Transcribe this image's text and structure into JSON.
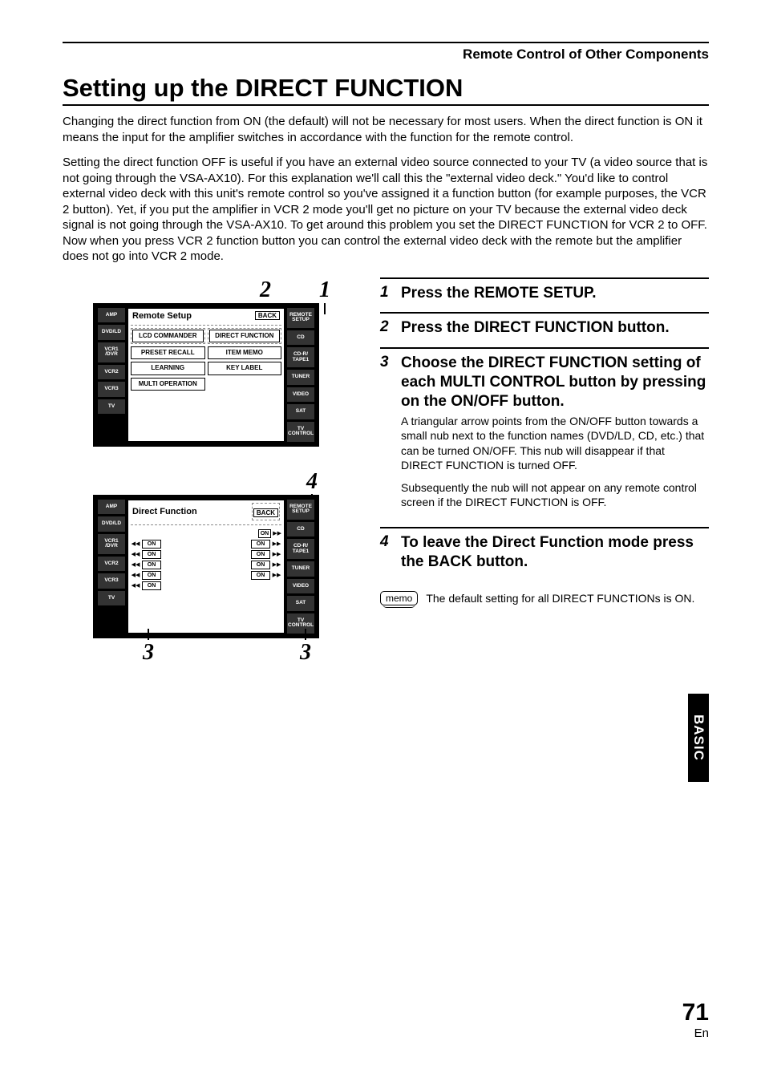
{
  "chapter": "Remote Control of Other Components",
  "title": "Setting up the DIRECT FUNCTION",
  "intro1": "Changing the direct function from ON (the default) will not be necessary for most users. When the direct function is ON it means the input for the amplifier switches in accordance with the function for the remote control.",
  "intro2": "Setting the direct function OFF is useful if you have an external video source connected to your TV (a video source that is not going through the VSA-AX10). For this explanation we'll call this the \"external video deck.\" You'd like to control external video deck with this unit's remote control so you've assigned it a function button (for example purposes, the VCR 2 button). Yet, if you put the amplifier in VCR 2 mode you'll get no picture on your TV because the external video deck signal is not going through the VSA-AX10. To get around this problem you set the DIRECT FUNCTION for VCR 2 to OFF. Now when you press VCR 2 function button you can control the external video deck with the remote but the amplifier does not go into VCR 2 mode.",
  "steps": [
    {
      "n": "1",
      "head": "Press the REMOTE SETUP.",
      "body": []
    },
    {
      "n": "2",
      "head": "Press the DIRECT FUNCTION button.",
      "body": []
    },
    {
      "n": "3",
      "head": "Choose the DIRECT FUNCTION setting of each MULTI CONTROL button by pressing on the ON/OFF button.",
      "body": [
        "A triangular arrow points from the ON/OFF button towards a small nub next to the function names (DVD/LD, CD, etc.) that can be turned ON/OFF. This nub will disappear if that DIRECT FUNCTION is turned OFF.",
        "Subsequently the nub will not appear on any remote control screen if the DIRECT FUNCTION is OFF."
      ]
    },
    {
      "n": "4",
      "head": "To leave the Direct Function mode press the BACK button.",
      "body": []
    }
  ],
  "memo_label": "memo",
  "memo_text": "The default setting for all DIRECT FUNCTIONs is ON.",
  "side_tab": "BASIC",
  "page_number": "71",
  "page_lang": "En",
  "callout_2": "2",
  "callout_1": "1",
  "callout_4": "4",
  "callout_3a": "3",
  "callout_3b": "3",
  "remote_left_labels": [
    "AMP",
    "DVD/LD",
    "VCR1\n/DVR",
    "VCR2",
    "VCR3",
    "TV"
  ],
  "remote_right_labels": [
    "REMOTE\nSETUP",
    "CD",
    "CD-R/\nTAPE1",
    "TUNER",
    "VIDEO",
    "SAT",
    "TV\nCONTROL"
  ],
  "screen1": {
    "title": "Remote Setup",
    "back": "BACK",
    "buttons_left": [
      "LCD\nCOMMANDER",
      "PRESET RECALL",
      "LEARNING",
      "MULTI OPERATION"
    ],
    "buttons_right": [
      "DIRECT FUNCTION",
      "ITEM MEMO",
      "KEY LABEL",
      ""
    ]
  },
  "screen2": {
    "title": "Direct Function",
    "back": "BACK",
    "on": "ON",
    "nav_l": "◀◀",
    "nav_r": "▶▶"
  }
}
